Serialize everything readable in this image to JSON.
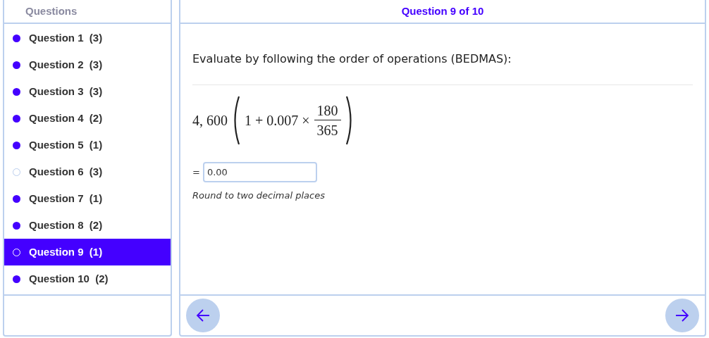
{
  "sidebar": {
    "title": "Questions",
    "items": [
      {
        "label": "Question 1  (3)",
        "answered": true,
        "selected": false
      },
      {
        "label": "Question 2  (3)",
        "answered": true,
        "selected": false
      },
      {
        "label": "Question 3  (3)",
        "answered": true,
        "selected": false
      },
      {
        "label": "Question 4  (2)",
        "answered": true,
        "selected": false
      },
      {
        "label": "Question 5  (1)",
        "answered": true,
        "selected": false
      },
      {
        "label": "Question 6  (3)",
        "answered": false,
        "selected": false
      },
      {
        "label": "Question 7  (1)",
        "answered": true,
        "selected": false
      },
      {
        "label": "Question 8  (2)",
        "answered": true,
        "selected": false
      },
      {
        "label": "Question 9  (1)",
        "answered": false,
        "selected": true
      },
      {
        "label": "Question 10  (2)",
        "answered": true,
        "selected": false
      }
    ]
  },
  "question": {
    "title": "Question 9 of 10",
    "prompt": "Evaluate by following the order of operations (BEDMAS):",
    "expression": {
      "coefficient": "4, 600",
      "inner": "1 + 0.007 ×",
      "numerator": "180",
      "denominator": "365"
    },
    "answer": {
      "label": "=",
      "value": "0.00"
    },
    "hint": "Round to two decimal places"
  }
}
